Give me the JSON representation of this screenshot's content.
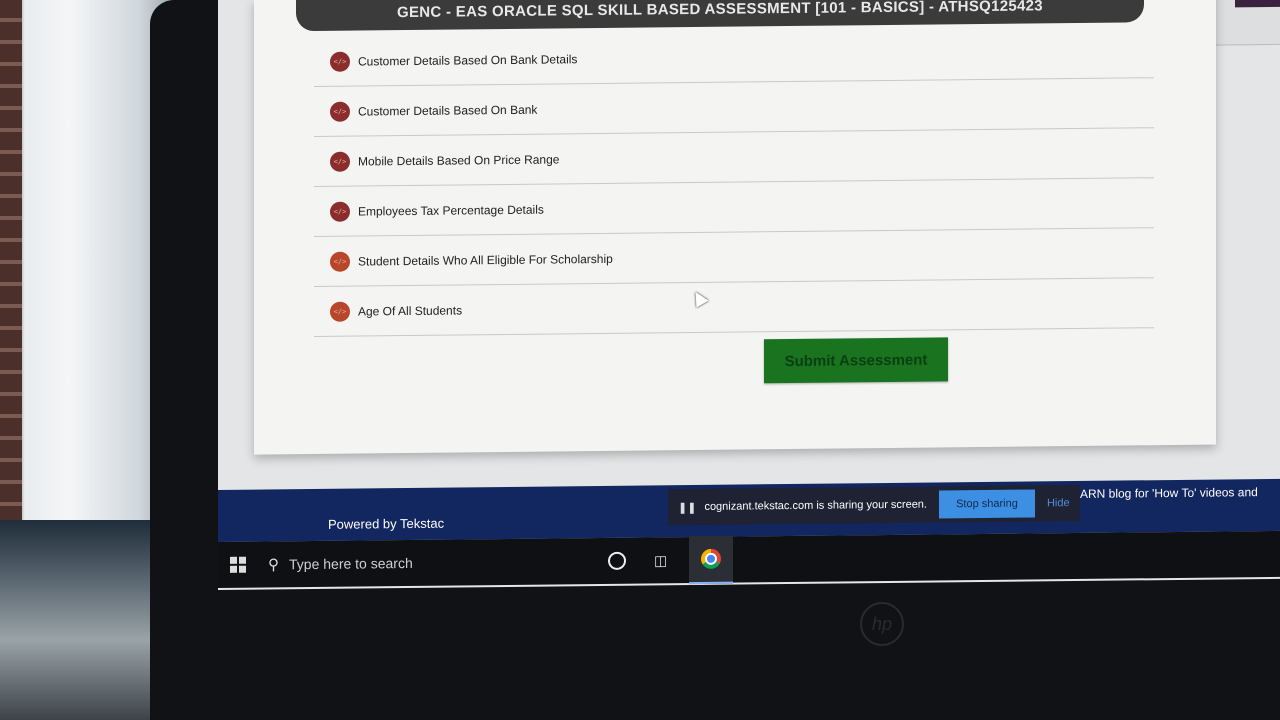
{
  "assessment": {
    "title": "GENC - EAS ORACLE SQL SKILL BASED ASSESSMENT [101 - BASICS] - ATHSQ125423",
    "questions": [
      {
        "label": "Customer Details Based On Bank Details",
        "icon": "code-icon"
      },
      {
        "label": "Customer Details Based On Bank",
        "icon": "code-icon"
      },
      {
        "label": "Mobile Details Based On Price Range",
        "icon": "code-icon"
      },
      {
        "label": "Employees Tax Percentage Details",
        "icon": "code-icon"
      },
      {
        "label": "Student Details Who All Eligible For Scholarship",
        "icon": "code-icon"
      },
      {
        "label": "Age Of All Students",
        "icon": "code-icon"
      }
    ],
    "submit_label": "Submit Assessment"
  },
  "footer": {
    "powered_by": "Powered by Tekstac",
    "ticker": "ARN blog for 'How To' videos and"
  },
  "screen_share": {
    "message": "cognizant.tekstac.com is sharing your screen.",
    "stop_label": "Stop sharing",
    "hide_label": "Hide"
  },
  "taskbar": {
    "search_placeholder": "Type here to search"
  },
  "colors": {
    "submit_bg": "#19731f",
    "title_bar_bg": "#3b3b3b",
    "footer_bg": "#12265f",
    "stop_sharing_bg": "#3d8fe4"
  }
}
